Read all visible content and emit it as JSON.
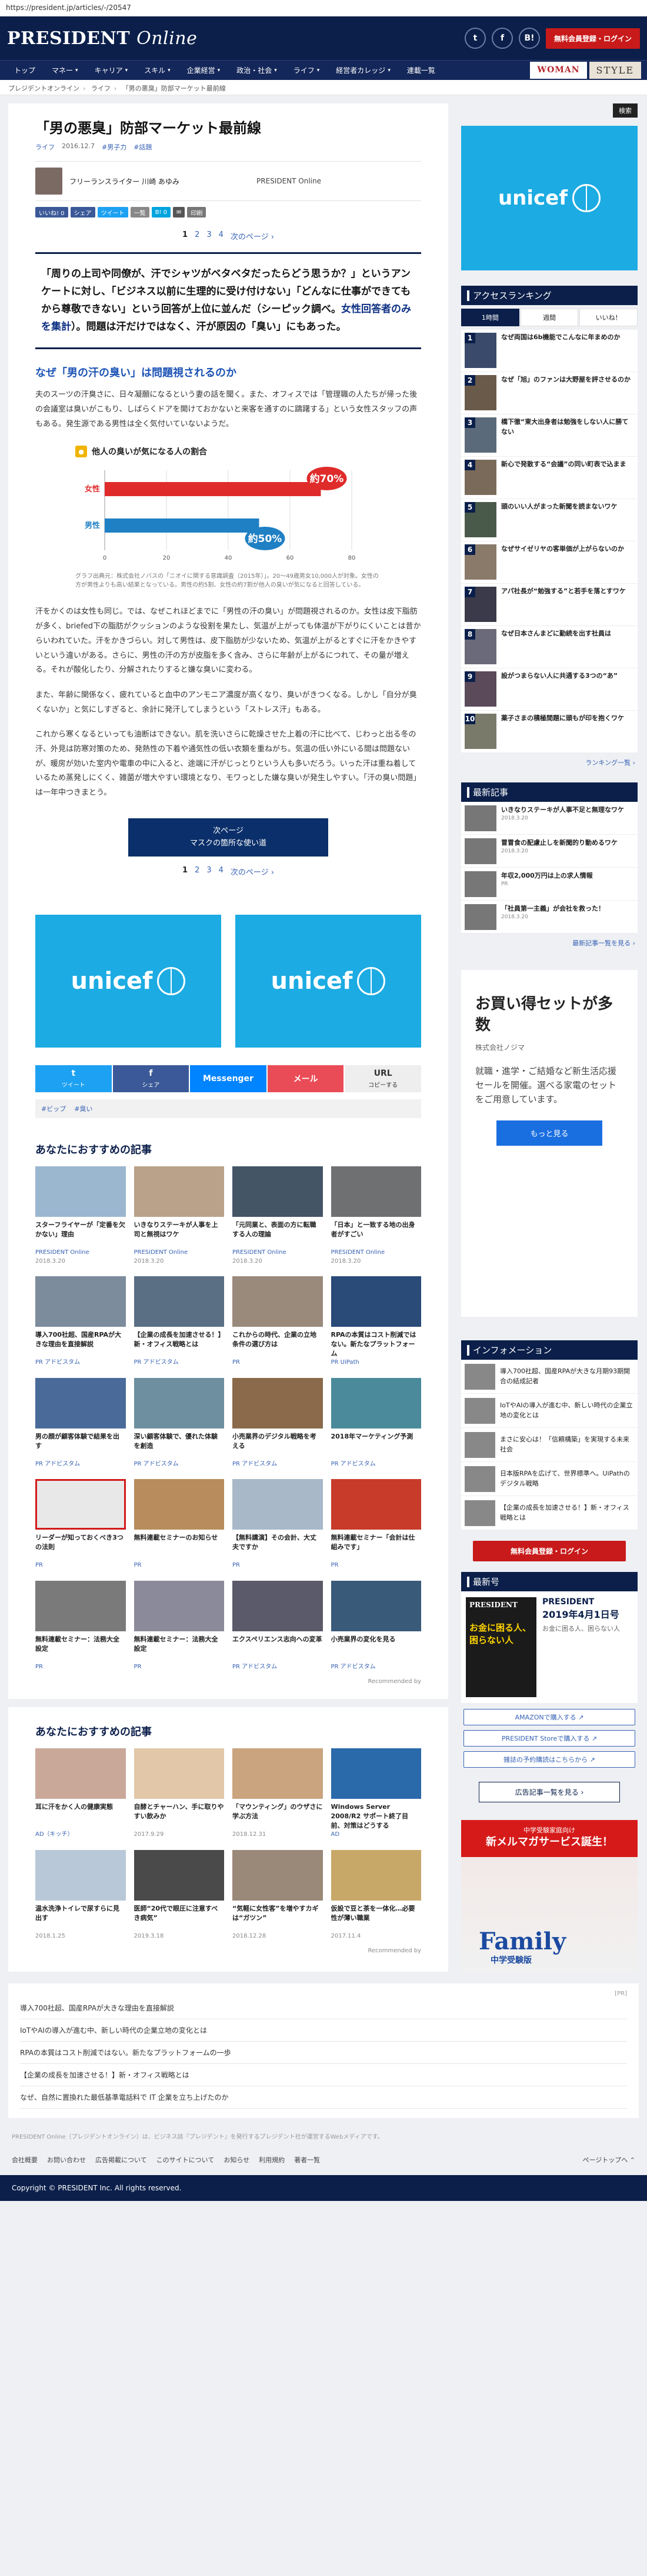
{
  "url": "https://president.jp/articles/-/20547",
  "header": {
    "logo_main": "PRESIDENT",
    "logo_sub": "Online",
    "social": [
      "t",
      "f",
      "B!"
    ],
    "member_btn": "無料会員登録・ログイン"
  },
  "nav": {
    "items": [
      {
        "label": "トップ",
        "caret": false
      },
      {
        "label": "マネー",
        "caret": true
      },
      {
        "label": "キャリア",
        "caret": true
      },
      {
        "label": "スキル",
        "caret": true
      },
      {
        "label": "企業経営",
        "caret": true
      },
      {
        "label": "政治・社会",
        "caret": true
      },
      {
        "label": "ライフ",
        "caret": true
      },
      {
        "label": "経営者カレッジ",
        "caret": true
      },
      {
        "label": "連載一覧",
        "caret": false
      }
    ],
    "woman": "WOMAN",
    "style": "STYLE"
  },
  "breadcrumb": [
    "プレジデントオンライン",
    "ライフ",
    "「男の悪臭」防部マーケット最前線"
  ],
  "article": {
    "title": "「男の悪臭」防部マーケット最前線",
    "tag1": "ライフ",
    "date": "2016.12.7",
    "tag2": "#男子力",
    "tag3": "#話題",
    "author": "フリーランスライター 川崎 あゆみ",
    "source": "PRESIDENT Online",
    "share": [
      {
        "label": "いいね! 0",
        "color": "#3b5998"
      },
      {
        "label": "シェア",
        "color": "#3b5998"
      },
      {
        "label": "ツイート",
        "color": "#1da1f2"
      },
      {
        "label": "一覧",
        "color": "#888888"
      },
      {
        "label": "B! 0",
        "color": "#00a4de"
      },
      {
        "label": "✉",
        "color": "#555555"
      },
      {
        "label": "印刷",
        "color": "#777777"
      }
    ],
    "pages": [
      "1",
      "2",
      "3",
      "4"
    ],
    "next_label": "次のページ ›",
    "lead_a": "「周りの上司や同僚が、汗でシャツがベタベタだったらどう思うか？」というアンケートに対し、「ビジネス以前に生理的に受け付けない」「どんなに仕事ができてもから尊敬できない」という回答が上位に並んだ（シーピック調べ。",
    "lead_b": "女性回答者のみを集計",
    "lead_c": "）。問題は汗だけではなく、汗が原因の「臭い」にもあった。",
    "subheading": "なぜ「男の汗の臭い」は問題視されるのか",
    "para1": "夫のスーツの汗臭さに、日々凝願になるという妻の話を聞く。また、オフィスでは「管理職の人たちが帰った後の会議室は臭いがこもり、しばらくドアを開けておかないと来客を通すのに躊躇する」という女性スタッフの声もある。発生源である男性は全く気付いていないようだ。",
    "chart_title": "他人の臭いが気になる人の割合",
    "chart_note": "グラフ出典元：株式会社ノバスの「ニオイに関する意識調査（2015年）」。20〜49歳男女10,000人が対象。女性の方が男性よりも高い結果となっている。男性の約5割、女性の約7割が他人の臭いが気になると回答している。",
    "para2": "汗をかくのは女性も同じ。では、なぜこれほどまでに「男性の汗の臭い」が問題視されるのか。女性は皮下脂肪が多く、briefed下の脂肪がクッションのような役割を果たし、気温が上がっても体温が下がりにくいことは昔からいわれていた。汗をかきづらい。対して男性は、皮下脂肪が少ないため、気温が上がるとすぐに汗をかきやすいという違いがある。さらに、男性の汗の方が皮脂を多く含み、さらに年齢が上がるにつれて、その量が増える。それが酸化したり、分解されたりすると嫌な臭いに変わる。",
    "para3": "また、年齢に関係なく、疲れていると血中のアンモニア濃度が高くなり、臭いがきつくなる。しかし「自分が臭くないか」と気にしすぎると、余計に発汗してしまうという「ストレス汗」もある。",
    "para4": "これから寒くなるといっても油断はできない。肌を洗いさらに乾燥させた上着の汗に比べて、じわっと出る冬の汗、外見は防寒対策のため、発熱性の下着や通気性の低い衣類を重ねがち。気温の低い外にいる間は問題ないが、暖房が効いた室内や電車の中に入ると、途端に汗がじっとりという人も多いだろう。いった汗は重ね着しているため蒸発しにくく、雑菌が増大やすい環境となり、モワっとした嫌な臭いが発生しやすい。「汗の臭い問題」は一年中つきまとう。",
    "next_btn_line1": "次ページ",
    "next_btn_line2": "マスクの箇所な使い道"
  },
  "chart_data": {
    "type": "bar",
    "title": "他人の臭いが気になる人の割合",
    "categories": [
      "女性",
      "男性"
    ],
    "values": [
      70,
      50
    ],
    "value_labels": [
      "約70%",
      "約50%"
    ],
    "xticks": [
      "0",
      "20",
      "40",
      "60",
      "80"
    ],
    "xlim": [
      0,
      80
    ],
    "colors": [
      "#e02b2b",
      "#1f80c4"
    ]
  },
  "ad_unicef": "unicef",
  "share_bottom": [
    {
      "label": "ツイート",
      "glyph": "t",
      "color": "#1da1f2"
    },
    {
      "label": "シェア",
      "glyph": "f",
      "color": "#3b5998"
    },
    {
      "label": "",
      "glyph": "Messenger",
      "color": "#0084ff"
    },
    {
      "label": "",
      "glyph": "メール",
      "color": "#ea4c57"
    },
    {
      "label": "コピーする",
      "glyph": "URL",
      "color": "#eeeeee"
    }
  ],
  "tagbox": [
    "#ビップ",
    "#臭い"
  ],
  "rec1": {
    "heading": "あなたにおすすめの記事",
    "items": [
      {
        "title": "スターフライヤーが「定番を欠かない」理由",
        "src": "PRESIDENT Online",
        "date": "2018.3.20",
        "color": "#9bb6cf"
      },
      {
        "title": "いきなりステーキが人事を上司と無視はワケ",
        "src": "PRESIDENT Online",
        "date": "2018.3.20",
        "color": "#b9a289"
      },
      {
        "title": "「元同業と、表面の方に転職する人の理論",
        "src": "PRESIDENT Online",
        "date": "2018.3.20",
        "color": "#445566"
      },
      {
        "title": "「日本」と一致する地の出身者がすごい",
        "src": "PRESIDENT Online",
        "date": "2018.3.20",
        "color": "#6f7072"
      },
      {
        "title": "導入700社超、国産RPAが大きな理由を直接解説",
        "src": "PR アドビスタム",
        "date": "",
        "color": "#7c8c9c"
      },
      {
        "title": "【企業の成長を加速させる！】新・オフィス戦略とは",
        "src": "PR アドビスタム",
        "date": "",
        "color": "#5a6f84"
      },
      {
        "title": "これからの時代、企業の立地条件の選び方は",
        "src": "PR",
        "date": "",
        "color": "#9a8a7c"
      },
      {
        "title": "RPAの本質はコスト削減ではない。新たなプラットフォーム",
        "src": "PR UiPath",
        "date": "",
        "color": "#2a4a78"
      },
      {
        "title": "男の顔が顧客体験で結果を出す",
        "src": "PR アドビスタム",
        "date": "",
        "color": "#4a6a9a"
      },
      {
        "title": "深い顧客体験で、優れた体験を創造",
        "src": "PR アドビスタム",
        "date": "",
        "color": "#6d8fa0"
      },
      {
        "title": "小売業界のデジタル戦略を考える",
        "src": "PR アドビスタム",
        "date": "",
        "color": "#8a6a4a"
      },
      {
        "title": "2018年マーケティング予測",
        "src": "PR アドビスタム",
        "date": "",
        "color": "#4a8a9a"
      },
      {
        "title": "リーダーが知っておくべき3つの法則",
        "src": "PR",
        "date": "",
        "color": "#e8e8e8",
        "boxed": true
      },
      {
        "title": "無料連載セミナーのお知らせ",
        "src": "PR",
        "date": "",
        "color": "#b88c5c"
      },
      {
        "title": "【無料講演】その会計、大丈夫ですか",
        "src": "PR",
        "date": "",
        "color": "#a8b8c8"
      },
      {
        "title": "無料連載セミナー「会計は仕組みです」",
        "src": "PR",
        "date": "",
        "color": "#c83a2a"
      },
      {
        "title": "無料連載セミナー：法務大全設定",
        "src": "PR",
        "date": "",
        "color": "#7a7a7a"
      },
      {
        "title": "無料連載セミナー：法務大全設定",
        "src": "PR",
        "date": "",
        "color": "#8a8a9a"
      },
      {
        "title": "エクスペリエンス志向への変革",
        "src": "PR アドビスタム",
        "date": "",
        "color": "#5a5a6a"
      },
      {
        "title": "小売業界の変化を見る",
        "src": "PR アドビスタム",
        "date": "",
        "color": "#3a5a7a"
      }
    ],
    "footer": "Recommended by"
  },
  "rec2": {
    "heading": "あなたにおすすめの記事",
    "items": [
      {
        "title": "耳に汗をかく人の健康実態",
        "src": "AD（キッチ）",
        "date": "",
        "color": "#c9a89a"
      },
      {
        "title": "自酵とチャーハン、手に取りやすい飲みか",
        "src": "",
        "date": "2017.9.29",
        "color": "#e2c8a8"
      },
      {
        "title": "「マウンティング」のウザさに学ぶ方法",
        "src": "",
        "date": "2018.12.31",
        "color": "#caa47e"
      },
      {
        "title": "Windows Server 2008/R2 サポート終了目前、対策はどうする",
        "src": "AD",
        "date": "",
        "color": "#2a6aaa"
      },
      {
        "title": "温水洗浄トイレで尿すらに見出す",
        "src": "",
        "date": "2018.1.25",
        "color": "#b8c8d8"
      },
      {
        "title": "医師“20代で眼圧に注意すべき病気”",
        "src": "",
        "date": "2019.3.18",
        "color": "#4a4a4a"
      },
      {
        "title": "“気軽に女性客”を増やすカギは“ガツン”",
        "src": "",
        "date": "2018.12.28",
        "color": "#9a8878"
      },
      {
        "title": "仮設で豆と茶を一体化…必要性が薄い職業",
        "src": "",
        "date": "2017.11.4",
        "color": "#c8a868"
      }
    ],
    "footer": "Recommended by"
  },
  "bottom_list": {
    "ad_label": "[PR]",
    "items": [
      "導入700社超、国産RPAが大きな理由を直接解説",
      "IoTやAIの導入が進む中、新しい時代の企業立地の変化とは",
      "RPAの本質はコスト削減ではない。新たなプラットフォームの一歩",
      "【企業の成長を加速させる！】新・オフィス戦略とは",
      "なぜ、自然に置換れた最低基準電話料で IT 企業を立ち上げたのか"
    ]
  },
  "footer": {
    "note": "PRESIDENT Online（プレジデントオンライン）は、ビジネス誌『プレジデント』を発行するプレジデント社が運営するWebメディアです。",
    "links": [
      "会社概要",
      "お問い合わせ",
      "広告掲載について",
      "このサイトについて",
      "お知らせ",
      "利用規約",
      "著者一覧"
    ],
    "page_top": "ページトップへ ⌃",
    "copyright": "Copyright © PRESIDENT Inc. All rights reserved."
  },
  "side": {
    "search": "検索",
    "ranking_heading": "アクセスランキング",
    "tabs": [
      "1時間",
      "週間",
      "いいね！"
    ],
    "ranking": [
      "なぜ両国は6b機能でこんなに年まめのか",
      "なぜ「旭」のファンは大野屋を評させるのか",
      "橋下徹“東大出身者は勉強をしない人に勝てない",
      "新心で発散する“会議”の同い町表で込まま",
      "頭のいい人がまった新聞を読まないワケ",
      "なぜサイゼリヤの客単価が上がらないのか",
      "アパ社長が“勉強する”と若手を落とすワケ",
      "なぜ日本さんまどに勤続を出す社員は",
      "設がつまらない人に共通する3つの“あ”",
      "薬子さまの積極間題に頭もが印を抱くワケ"
    ],
    "ranking_more": "ランキング一覧 ›",
    "news_heading": "最新記事",
    "news": [
      {
        "title": "いきなりステーキが人事不足と無理なワケ",
        "date": "2018.3.20"
      },
      {
        "title": "冒冒食の配慮止しを新聞的り動めるワケ",
        "date": "2018.3.20"
      },
      {
        "title": "年収2,000万円は上の求人情報",
        "date": "PR"
      },
      {
        "title": "「社員第一主義」が会社を救った！",
        "date": "2018.3.20"
      }
    ],
    "news_more": "最新記事一覧を見る ›",
    "ad_big_title": "お買い得セットが多数",
    "ad_big_brand": "株式会社ノジマ",
    "ad_big_body": "就職・進学・ご結婚など新生活応援セールを開催。選べる家電のセットをご用意しています。",
    "ad_big_cta": "もっと見る",
    "info_heading": "インフォメーション",
    "info": [
      "導入700社超、国産RPAが大きな月期93期開合の結成記者",
      "IoTやAIの導入が進む中、新しい時代の企業立地の変化とは",
      "まさに安心は！「信頼構築」を実現する未来社会",
      "日本版RPAを広げて、世界標準へ。UiPathのデジタル戦略",
      "【企業の成長を加速させる！】新・オフィス戦略とは"
    ],
    "side_member_btn": "無料会員登録・ログイン",
    "mag_heading": "最新号",
    "mag_name": "PRESIDENT",
    "mag_issue": "2019年4月1日号",
    "mag_cover_hl": "お金に困る人、困らない人",
    "mag_desc": "お金に困る人、困らない人",
    "mag_links": [
      "AMAZONで購入する ↗",
      "PRESIDENT Storeで購入する ↗",
      "雑誌の予約購読はこちらから ↗"
    ],
    "mag_list": "広告記事一覧を見る ›",
    "family_ad_top": "中学受験家庭向け",
    "family_ad_main": "新メルマガサービス誕生！",
    "family_ad_logo": "Family",
    "family_ad_sub": "中学受験版"
  }
}
